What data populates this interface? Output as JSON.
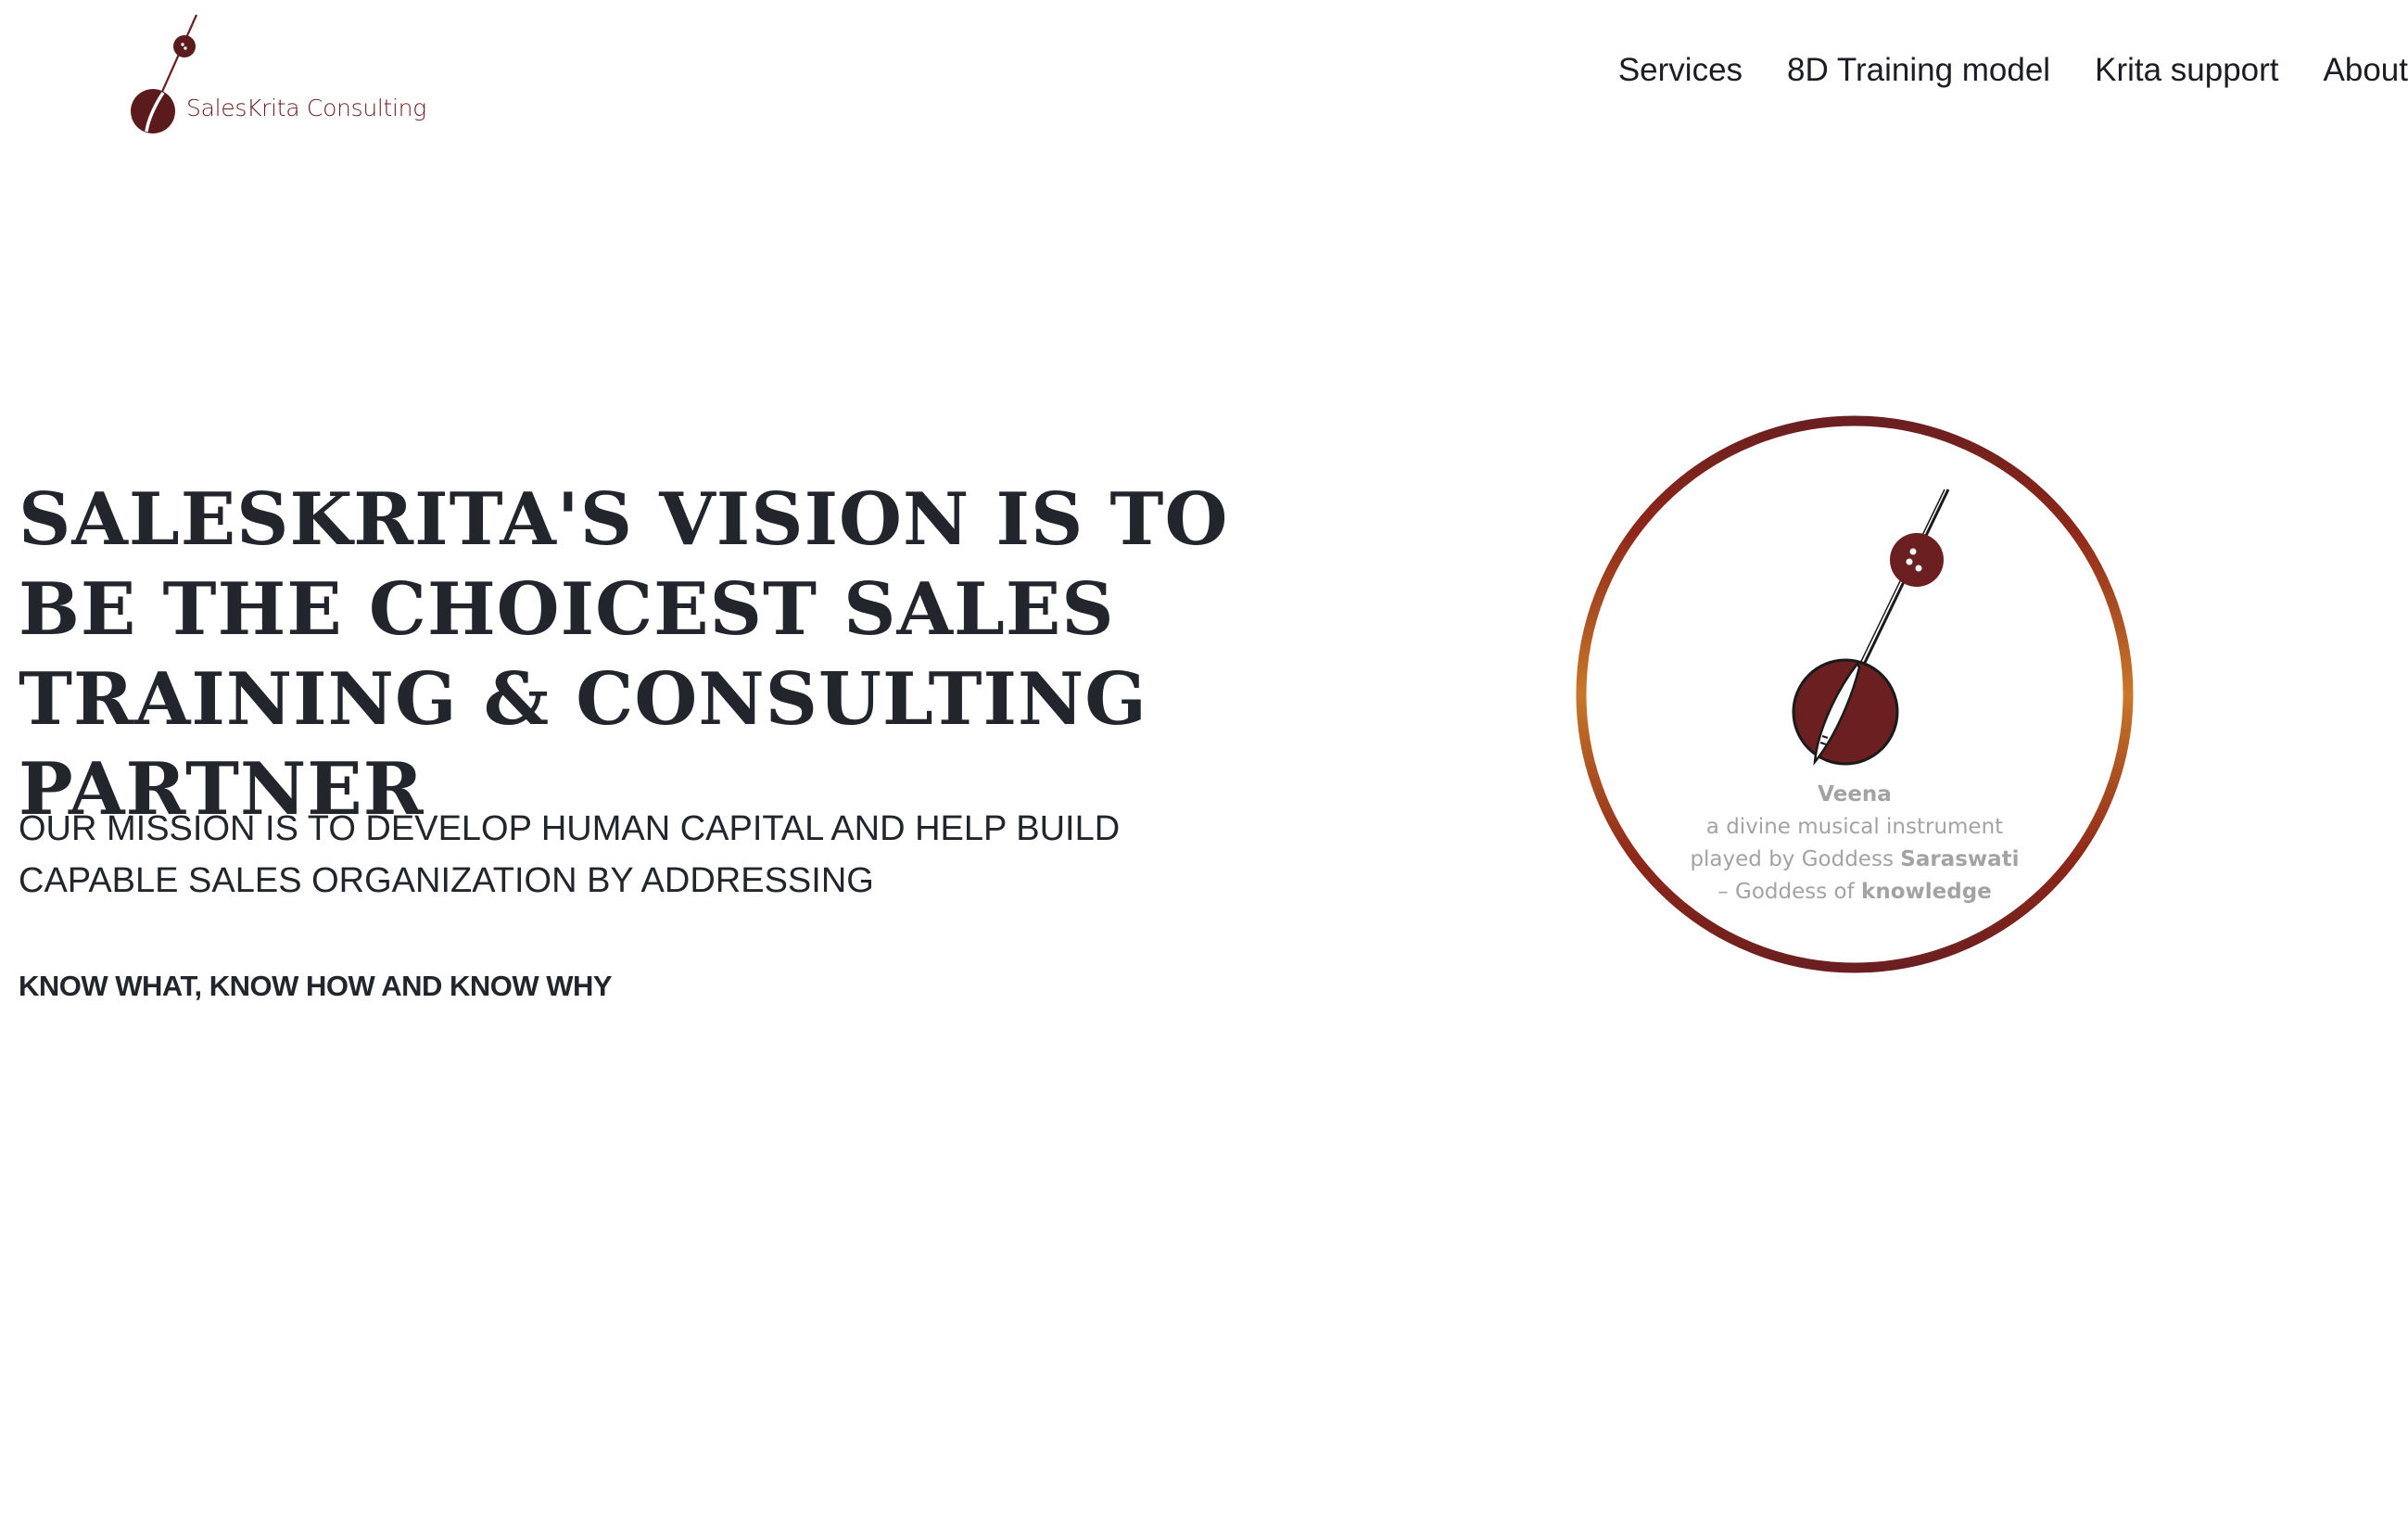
{
  "brand": {
    "name": "SalesKrita Consulting",
    "logo_icon": "veena-icon",
    "color": "#6b1f20"
  },
  "nav": {
    "items": [
      {
        "label": "Services"
      },
      {
        "label": "8D Training model"
      },
      {
        "label": "Krita support"
      },
      {
        "label": "About"
      }
    ]
  },
  "hero": {
    "vision": "SALESKRITA'S VISION IS TO BE THE CHOICEST SALES TRAINING & CONSULTING PARTNER",
    "mission": "OUR MISSION IS TO DEVELOP HUMAN CAPITAL AND HELP BUILD CAPABLE SALES ORGANIZATION BY ADDRESSING",
    "tagline": "KNOW WHAT, KNOW HOW AND KNOW WHY"
  },
  "emblem": {
    "icon": "veena-icon",
    "ring_colors": [
      "#6b1f20",
      "#c8782a"
    ],
    "caption": {
      "title": "Veena",
      "line1": "a divine musical instrument",
      "line2_prefix": "played by Goddess ",
      "line2_strong": "Saraswati",
      "line3_prefix": "– Goddess of ",
      "line3_strong": "knowledge"
    }
  }
}
